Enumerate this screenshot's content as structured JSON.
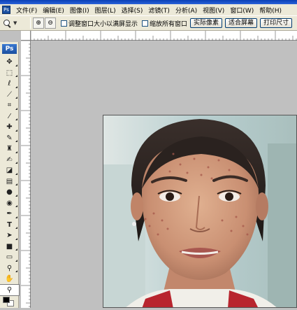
{
  "app": {
    "menu": [
      "文件(F)",
      "编辑(E)",
      "图像(I)",
      "图层(L)",
      "选择(S)",
      "滤镜(T)",
      "分析(A)",
      "视图(V)",
      "窗口(W)",
      "帮助(H)"
    ]
  },
  "options": {
    "checkbox_resize": "调整窗口大小以满屏显示",
    "checkbox_all_windows": "缩放所有窗口",
    "btn_actual_pixels": "实际像素",
    "btn_fit_screen": "适合屏幕",
    "btn_print_size": "打印尺寸"
  },
  "toolbox": {
    "logo": "Ps"
  },
  "colors": {
    "chrome": "#ece9d8",
    "workspace": "#c0c0c0",
    "ps_blue": "#1a4fa0"
  },
  "icons": [
    "move-tool-icon",
    "marquee-tool-icon",
    "lasso-tool-icon",
    "magic-wand-tool-icon",
    "crop-tool-icon",
    "eyedropper-spot-icon",
    "healing-brush-tool-icon",
    "brush-tool-icon",
    "clone-stamp-tool-icon",
    "history-brush-tool-icon",
    "eraser-tool-icon",
    "gradient-tool-icon",
    "blur-tool-icon",
    "dodge-tool-icon",
    "pen-tool-icon",
    "type-tool-icon",
    "path-selection-tool-icon",
    "shape-tool-icon",
    "notes-tool-icon",
    "eyedropper-tool-icon",
    "hand-tool-icon",
    "zoom-tool-icon"
  ]
}
